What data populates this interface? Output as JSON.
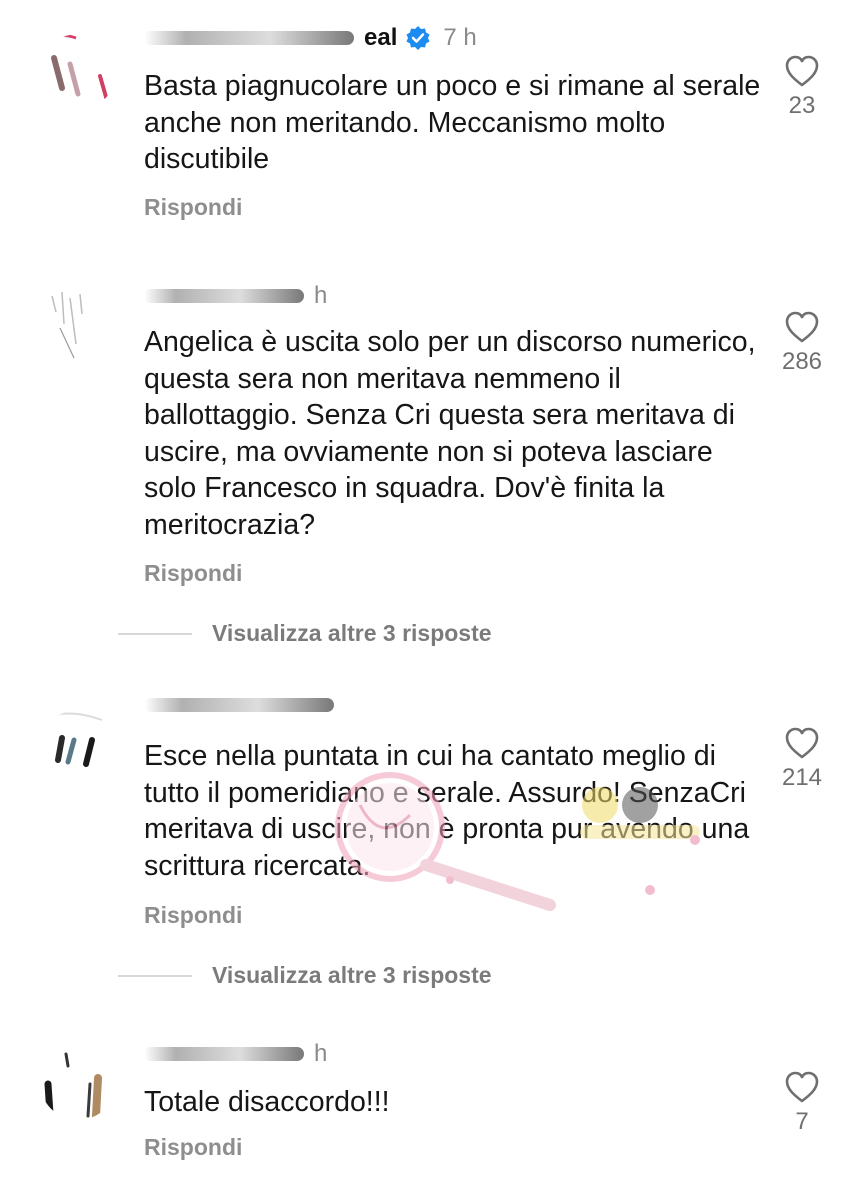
{
  "comments": [
    {
      "username_visible": "eal",
      "verified": true,
      "time": "7 h",
      "text": "Basta piagnucolare un poco e si rimane al serale anche non meritando. Meccanismo molto discutibile",
      "likes": "23",
      "reply_label": "Rispondi"
    },
    {
      "username_visible": "",
      "time": "h",
      "text": "Angelica è uscita solo per un discorso numerico, questa sera non meritava nemmeno il ballottaggio. Senza Cri questa sera meritava di uscire, ma ovviamente non si poteva lasciare solo Francesco in squadra. Dov'è finita la meritocrazia?",
      "likes": "286",
      "reply_label": "Rispondi",
      "more_replies": "Visualizza altre 3 risposte"
    },
    {
      "username_visible": "",
      "time": "",
      "text": "Esce nella puntata in cui ha cantato meglio di tutto il pomeridiano e serale. Assurdo! SenzaCri meritava di uscire, non è pronta pur avendo una scrittura ricercata.",
      "likes": "214",
      "reply_label": "Rispondi",
      "more_replies": "Visualizza altre 3 risposte"
    },
    {
      "username_visible": "",
      "time": "h",
      "text": "Totale disaccordo!!!",
      "likes": "7",
      "reply_label": "Rispondi"
    }
  ],
  "icons": {
    "like": "heart-outline-icon",
    "verified": "verified-badge-icon"
  },
  "colors": {
    "verified_blue": "#1d8cf0",
    "secondary_text": "#8e8e8e"
  }
}
